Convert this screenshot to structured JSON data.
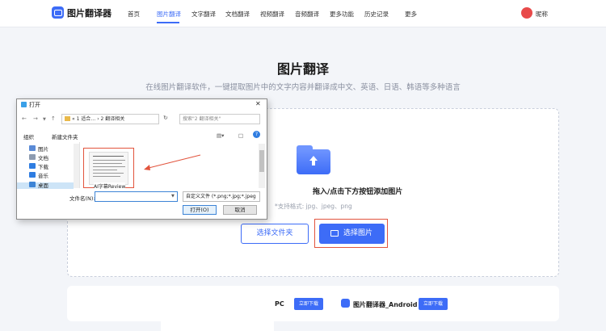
{
  "app": {
    "title": "图片翻译器"
  },
  "nav": {
    "items": [
      {
        "label": "首页",
        "active": false
      },
      {
        "label": "图片翻译",
        "active": true
      },
      {
        "label": "文字翻译",
        "active": false
      },
      {
        "label": "文档翻译",
        "active": false
      },
      {
        "label": "视频翻译",
        "active": false
      },
      {
        "label": "音频翻译",
        "active": false
      },
      {
        "label": "更多功能",
        "active": false
      },
      {
        "label": "历史记录",
        "active": false
      },
      {
        "label": "更多",
        "active": false
      }
    ],
    "user": "昵称"
  },
  "hero": {
    "title": "图片翻译",
    "subtitle": "在线图片翻译软件，一键提取图片中的文字内容并翻译成中文、英语、日语、韩语等多种语言"
  },
  "upload": {
    "drop_text": "拖入/点击下方按钮添加图片",
    "formats": "*支持格式: jpg、jpeg、png",
    "select_folder": "选择文件夹",
    "select_image": "选择图片"
  },
  "downloads": {
    "pc_label": "PC",
    "pc_button": "立即下载",
    "android_label": "图片翻译器_Android",
    "android_button": "立即下载"
  },
  "dialog": {
    "title": "打开",
    "address": "« 1 适合… › 2 翻译相关",
    "search_placeholder": "搜索\"2 翻译相关\"",
    "organize": "组织",
    "new_folder": "新建文件夹",
    "sidebar": [
      "图片",
      "文档",
      "下载",
      "音乐",
      "桌面"
    ],
    "thumbnail_name": "AI字幕Review",
    "filename_label": "文件名(N):",
    "filename_value": "",
    "filetype": "自定义文件 (*.png;*.jpg;*.jpeg",
    "open_button": "打开(O)",
    "cancel_button": "取消"
  },
  "colors": {
    "accent": "#3d6cf7",
    "highlight": "#e2543d"
  }
}
